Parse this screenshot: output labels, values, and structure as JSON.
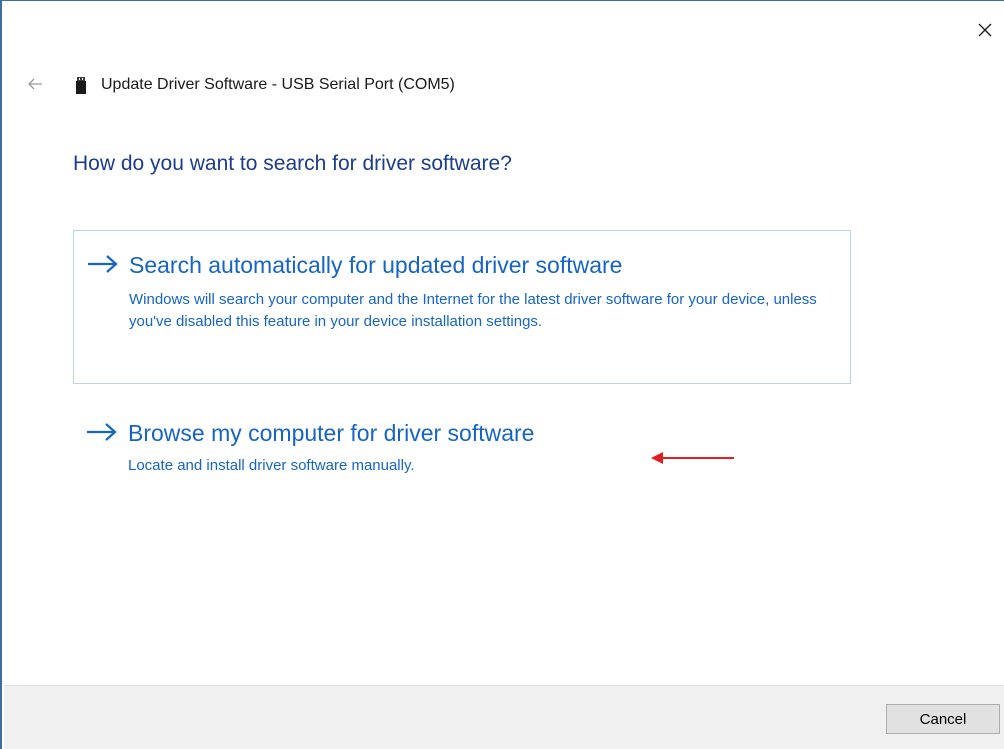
{
  "window": {
    "title": "Update Driver Software - USB Serial Port (COM5)",
    "close_icon": "close-icon",
    "back_icon": "back-arrow-icon",
    "device_icon": "usb-device-icon"
  },
  "main": {
    "heading": "How do you want to search for driver software?",
    "options": [
      {
        "title": "Search automatically for updated driver software",
        "description": "Windows will search your computer and the Internet for the latest driver software for your device, unless you've disabled this feature in your device installation settings.",
        "icon": "arrow-right-icon"
      },
      {
        "title": "Browse my computer for driver software",
        "description": "Locate and install driver software manually.",
        "icon": "arrow-right-icon"
      }
    ]
  },
  "annotation": {
    "icon": "red-arrow-left-icon",
    "color": "#e02020"
  },
  "footer": {
    "cancel_label": "Cancel"
  },
  "colors": {
    "heading": "#1c3c8c",
    "link": "#1665c5",
    "option_border": "#b7d6ee",
    "footer_bg": "#f0f0f0",
    "window_border": "#3c6ea5"
  }
}
